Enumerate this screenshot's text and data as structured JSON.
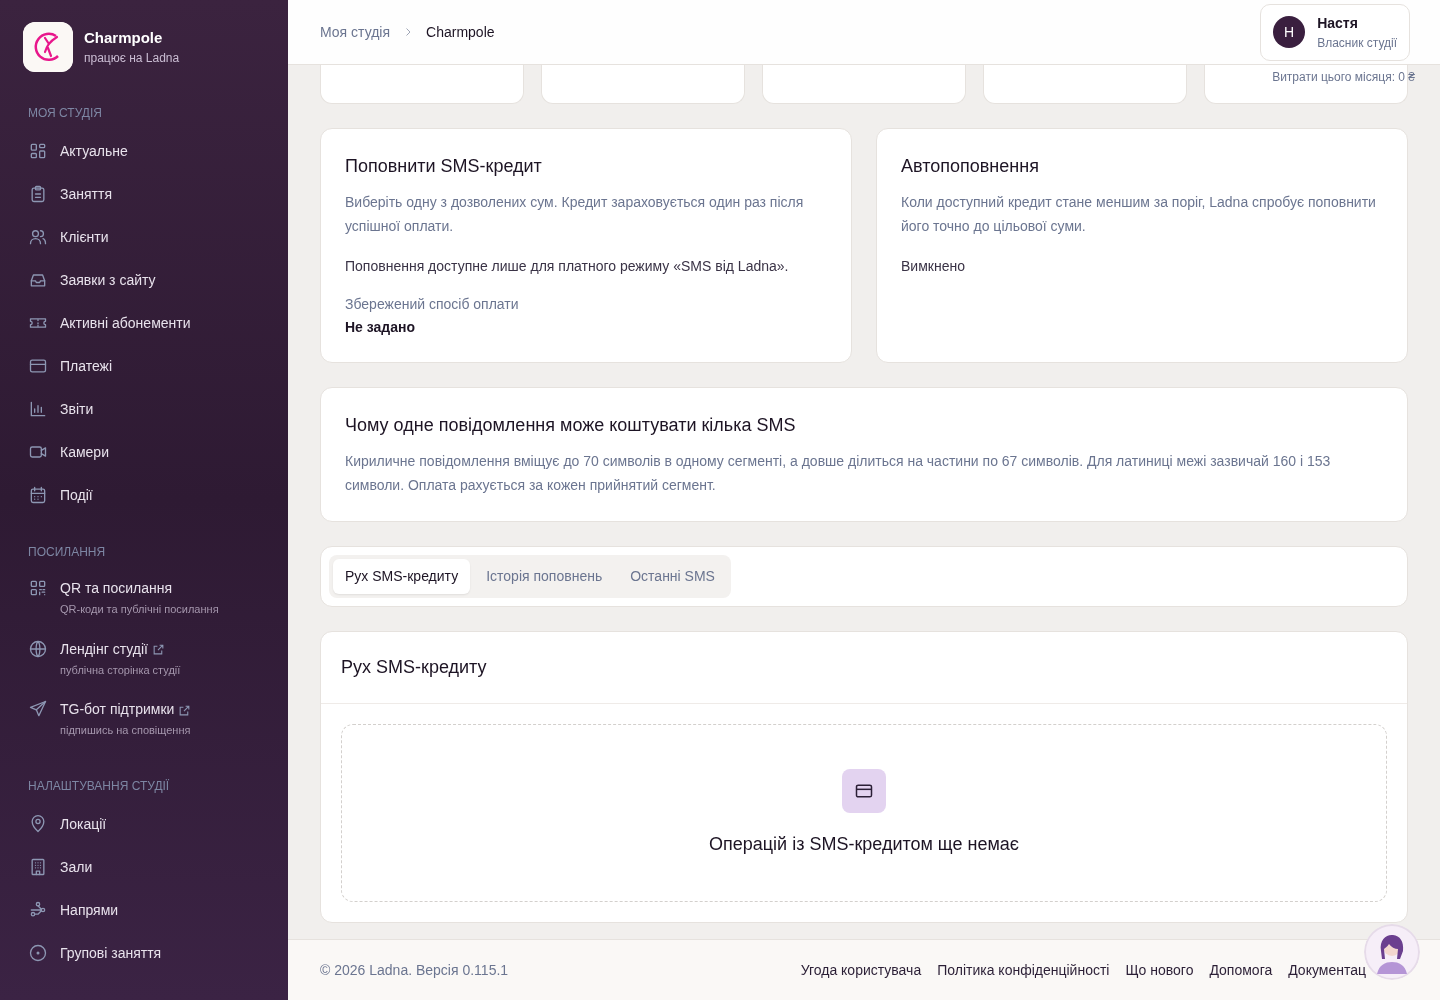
{
  "brand": {
    "name": "Charmpole",
    "subtitle": "працює на Ladna"
  },
  "sidebar": {
    "sections": [
      {
        "title": "МОЯ СТУДІЯ",
        "items": [
          {
            "label": "Актуальне"
          },
          {
            "label": "Заняття"
          },
          {
            "label": "Клієнти"
          },
          {
            "label": "Заявки з сайту"
          },
          {
            "label": "Активні абонементи"
          },
          {
            "label": "Платежі"
          },
          {
            "label": "Звіти"
          },
          {
            "label": "Камери"
          },
          {
            "label": "Події"
          }
        ]
      },
      {
        "title": "ПОСИЛАННЯ",
        "items": [
          {
            "label": "QR та посилання",
            "sublabel": "QR-коди та публічні посилання",
            "external": false
          },
          {
            "label": "Лендінг студії",
            "sublabel": "публічна сторінка студії",
            "external": true
          },
          {
            "label": "TG-бот підтримки",
            "sublabel": "підпишись на сповіщення",
            "external": true
          }
        ]
      },
      {
        "title": "НАЛАШТУВАННЯ СТУДІЇ",
        "items": [
          {
            "label": "Локації"
          },
          {
            "label": "Зали"
          },
          {
            "label": "Напрями"
          },
          {
            "label": "Групові заняття"
          }
        ]
      }
    ]
  },
  "breadcrumb": [
    "Моя студія",
    "Charmpole"
  ],
  "user": {
    "initial": "Н",
    "name": "Настя",
    "role": "Власник студії"
  },
  "summary_note": "Витрати цього місяця: 0 ₴",
  "topup": {
    "title": "Поповнити SMS-кредит",
    "description": "Виберіть одну з дозволених сум. Кредит зараховується один раз після успішної оплати.",
    "note": "Поповнення доступне лише для платного режиму «SMS від Ladna».",
    "saved_label": "Збережений спосіб оплати",
    "saved_value": "Не задано"
  },
  "autotopup": {
    "title": "Автопоповнення",
    "description": "Коли доступний кредит стане меншим за поріг, Ladna спробує поповнити його точно до цільової суми.",
    "status": "Вимкнено"
  },
  "info": {
    "title": "Чому одне повідомлення може коштувати кілька SMS",
    "text": "Кириличне повідомлення вміщує до 70 символів в одному сегменті, а довше ділиться на частини по 67 символів. Для латиниці межі зазвичай 160 і 153 символи. Оплата рахується за кожен прийнятий сегмент."
  },
  "tabs": [
    {
      "label": "Рух SMS-кредиту",
      "selected": true
    },
    {
      "label": "Історія поповнень",
      "selected": false
    },
    {
      "label": "Останні SMS",
      "selected": false
    }
  ],
  "panel": {
    "title": "Рух SMS-кредиту",
    "empty_text": "Операцій із SMS-кредитом ще немає"
  },
  "footer": {
    "copyright": "© 2026 Ladna. Версія 0.115.1",
    "links": [
      "Угода користувача",
      "Політика конфіденційності",
      "Що нового",
      "Допомога",
      "Документац"
    ]
  }
}
